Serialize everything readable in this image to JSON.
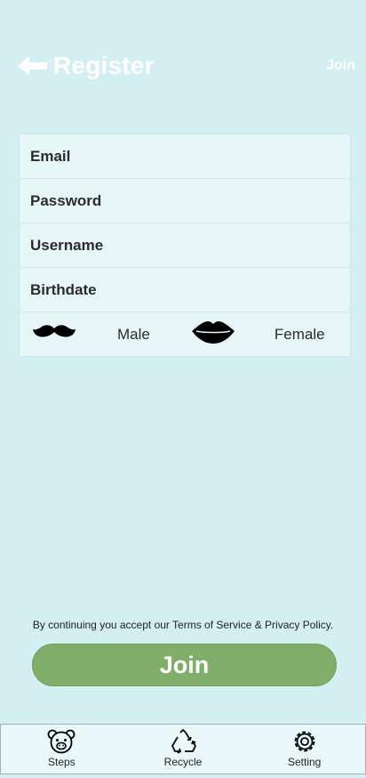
{
  "header": {
    "title": "Register",
    "join_label": "Join",
    "back_icon": "arrow-left-icon"
  },
  "form": {
    "fields": [
      {
        "label": "Email"
      },
      {
        "label": "Password"
      },
      {
        "label": "Username"
      },
      {
        "label": "Birthdate"
      }
    ],
    "gender": {
      "male_label": "Male",
      "female_label": "Female",
      "male_icon": "mustache-icon",
      "female_icon": "lips-icon"
    }
  },
  "terms_text": "By continuing you accept our Terms of Service & Privacy Policy.",
  "join_button": {
    "label": "Join",
    "color": "#80ae6a"
  },
  "nav": {
    "items": [
      {
        "label": "Steps",
        "icon": "bear-face-icon"
      },
      {
        "label": "Recycle",
        "icon": "recycle-icon"
      },
      {
        "label": "Setting",
        "icon": "gear-icon"
      }
    ]
  },
  "colors": {
    "background": "#d3eff1",
    "form_background": "#e6f6f7",
    "nav_background": "#e9f7f8"
  }
}
